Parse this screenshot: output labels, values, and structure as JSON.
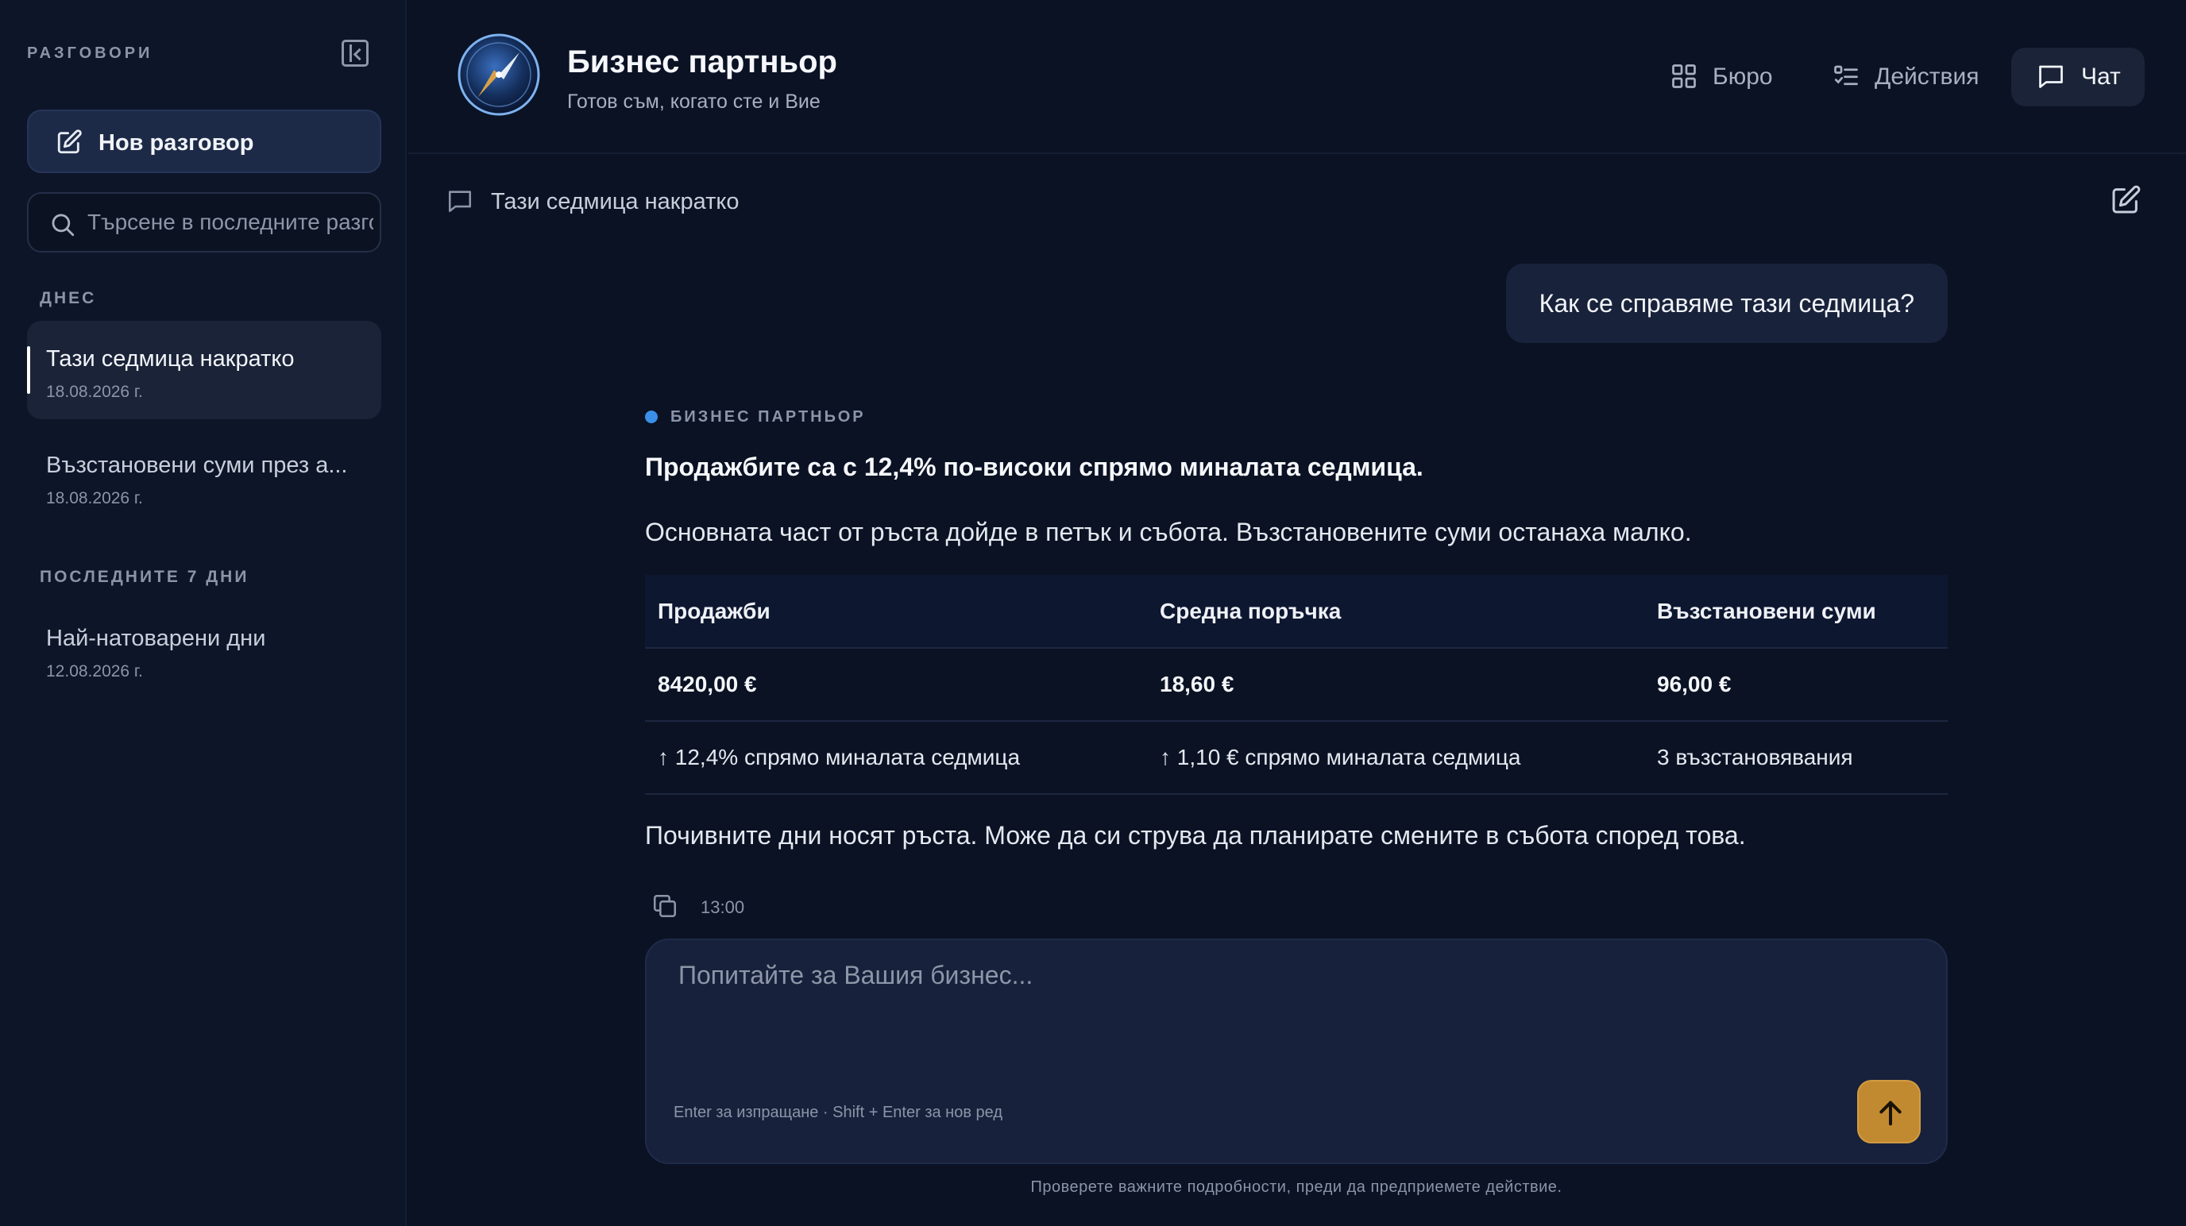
{
  "sidebar": {
    "title": "РАЗГОВОРИ",
    "new_chat_label": "Нов разговор",
    "search_placeholder": "Търсене в последните разговори",
    "groups": [
      {
        "label": "ДНЕС",
        "items": [
          {
            "title": "Тази седмица накратко",
            "date": "18.08.2026 г.",
            "active": true
          },
          {
            "title": "Възстановени суми през а...",
            "date": "18.08.2026 г.",
            "active": false
          }
        ]
      },
      {
        "label": "ПОСЛЕДНИТЕ 7 ДНИ",
        "items": [
          {
            "title": "Най-натоварени дни",
            "date": "12.08.2026 г.",
            "active": false
          }
        ]
      }
    ]
  },
  "header": {
    "title": "Бизнес партньор",
    "subtitle": "Готов съм, когато сте и Вие",
    "nav": [
      {
        "label": "Бюро",
        "icon": "grid-icon",
        "active": false
      },
      {
        "label": "Действия",
        "icon": "checklist-icon",
        "active": false
      },
      {
        "label": "Чат",
        "icon": "chat-icon",
        "active": true
      }
    ]
  },
  "thread": {
    "title": "Тази седмица накратко",
    "user_message": "Как се справяме тази седмица?",
    "assistant": {
      "label": "БИЗНЕС ПАРТНЬОР",
      "headline": "Продажбите са с 12,4% по-високи спрямо миналата седмица.",
      "paragraph1": "Основната част от ръста дойде в петък и събота. Възстановените суми останаха малко.",
      "table": {
        "headers": [
          "Продажби",
          "Средна поръчка",
          "Възстановени суми"
        ],
        "values": [
          "8420,00 €",
          "18,60 €",
          "96,00 €"
        ],
        "changes": [
          "↑ 12,4% спрямо миналата седмица",
          "↑ 1,10 € спрямо миналата седмица",
          "3 възстановявания"
        ]
      },
      "paragraph2": "Почивните дни носят ръста. Може да си струва да планирате смените в събота според това.",
      "time": "13:00"
    }
  },
  "composer": {
    "placeholder": "Попитайте за Вашия бизнес...",
    "hint": "Enter за изпращане · Shift + Enter за нов ред",
    "footnote": "Проверете важните подробности, преди да предприемете действие."
  },
  "colors": {
    "background": "#0a1224",
    "sidebar": "#0d1528",
    "accent_send": "#c28a30",
    "accent_dot": "#3b8fe8"
  }
}
